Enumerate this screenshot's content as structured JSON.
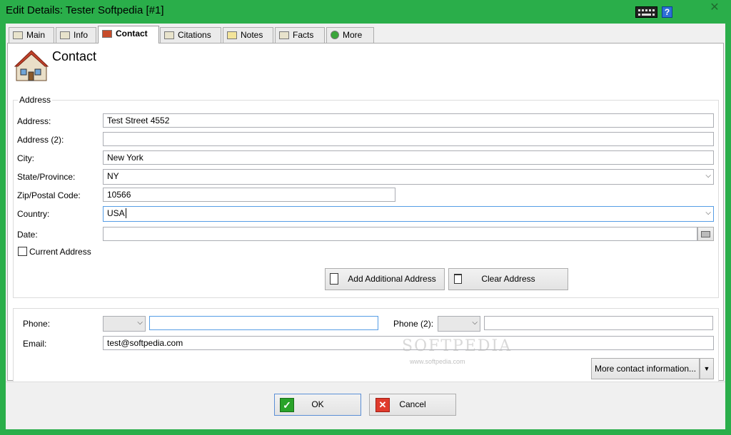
{
  "window": {
    "title": "Edit Details: Tester Softpedia [#1]",
    "help_glyph": "?",
    "close_glyph": "✕"
  },
  "tabs": [
    {
      "label": "Main",
      "icon": "person-card-icon"
    },
    {
      "label": "Info",
      "icon": "info-card-icon"
    },
    {
      "label": "Contact",
      "icon": "house-icon",
      "active": true
    },
    {
      "label": "Citations",
      "icon": "citation-icon"
    },
    {
      "label": "Notes",
      "icon": "note-icon"
    },
    {
      "label": "Facts",
      "icon": "facts-icon"
    },
    {
      "label": "More",
      "icon": "plus-icon"
    }
  ],
  "page": {
    "heading": "Contact"
  },
  "address": {
    "group_title": "Address",
    "address_label": "Address:",
    "address_value": "Test Street 4552",
    "address2_label": "Address (2):",
    "address2_value": "",
    "city_label": "City:",
    "city_value": "New York",
    "state_label": "State/Province:",
    "state_value": "NY",
    "zip_label": "Zip/Postal Code:",
    "zip_value": "10566",
    "country_label": "Country:",
    "country_value": "USA",
    "date_label": "Date:",
    "date_value": "",
    "current_label": "Current Address",
    "add_button": "Add Additional Address",
    "clear_button": "Clear Address"
  },
  "contact": {
    "phone_label": "Phone:",
    "phone_type": "",
    "phone_value": "",
    "phone2_label": "Phone (2):",
    "phone2_type": "",
    "phone2_value": "",
    "email_label": "Email:",
    "email_value": "test@softpedia.com",
    "more_button": "More contact information..."
  },
  "footer": {
    "ok": "OK",
    "cancel": "Cancel"
  },
  "watermark": {
    "main": "SOFTPEDIA",
    "url": "www.softpedia.com"
  },
  "colors": {
    "titlebar": "#2aae4a",
    "focus_border": "#569de5"
  }
}
